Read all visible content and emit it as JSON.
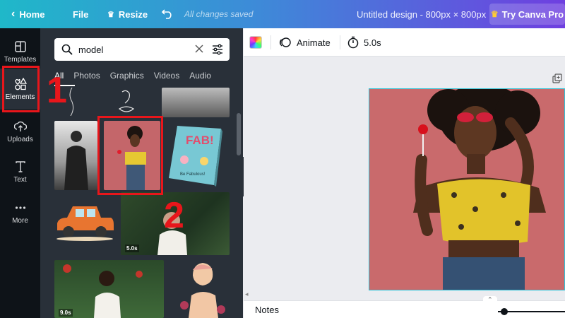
{
  "topbar": {
    "home_label": "Home",
    "file_label": "File",
    "resize_label": "Resize",
    "saved_status": "All changes saved",
    "doc_title": "Untitled design - 800px × 800px",
    "try_pro_label": "Try Canva Pro"
  },
  "rail": {
    "items": [
      {
        "label": "Templates",
        "icon": "templates-icon"
      },
      {
        "label": "Elements",
        "icon": "elements-icon"
      },
      {
        "label": "Uploads",
        "icon": "upload-icon"
      },
      {
        "label": "Text",
        "icon": "text-icon"
      },
      {
        "label": "More",
        "icon": "more-icon"
      }
    ]
  },
  "panel": {
    "search_value": "model",
    "tabs": [
      "All",
      "Photos",
      "Graphics",
      "Videos",
      "Audio"
    ],
    "video_durations": [
      "5.0s",
      "9.0s"
    ],
    "book_cover_text": "FAB!",
    "book_subtitle": "Be Fabulous!"
  },
  "annotations": {
    "step1": "1",
    "step2": "2",
    "highlight_color": "#e8161b"
  },
  "toolbar": {
    "animate_label": "Animate",
    "duration_label": "5.0s"
  },
  "footer": {
    "notes_label": "Notes"
  },
  "colors": {
    "gradient_start": "#1fb8c9",
    "gradient_end": "#6f3fe0",
    "rail_bg": "#0e1318",
    "panel_bg": "#293039",
    "design_bg": "#c96a6c",
    "selection": "#31c4d8"
  }
}
